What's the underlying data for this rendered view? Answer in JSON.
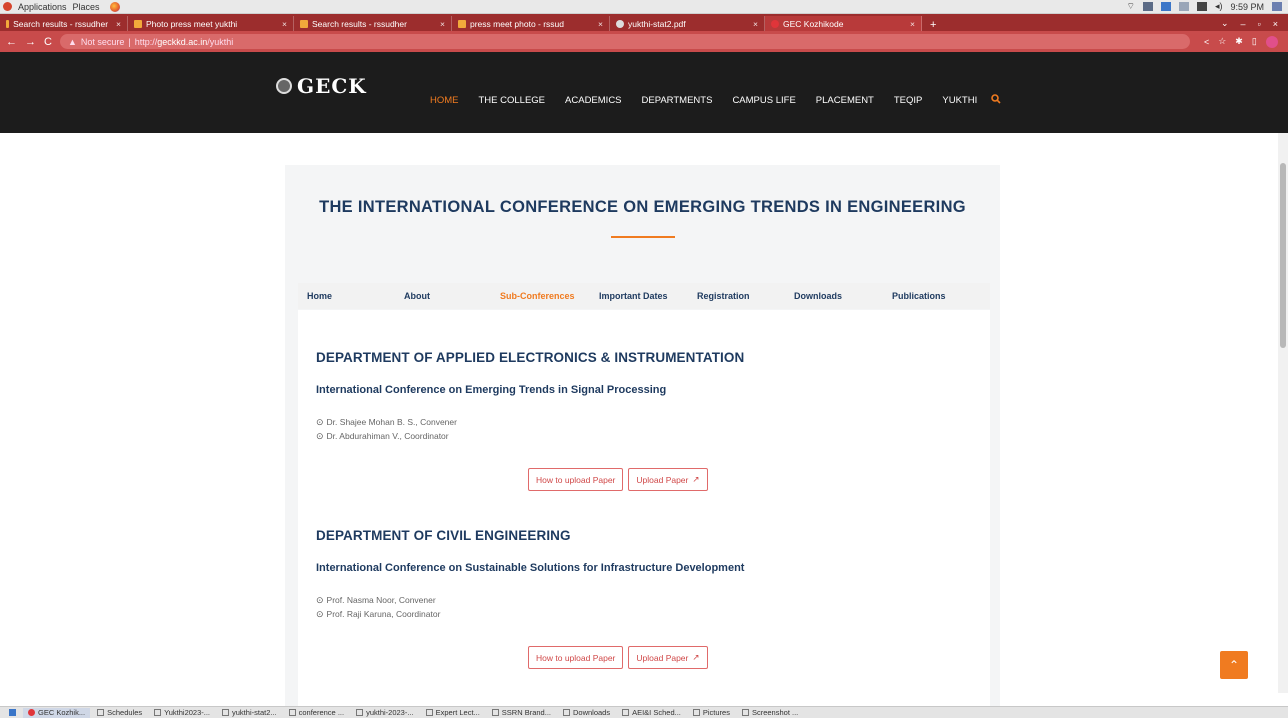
{
  "os_top": {
    "menu_applications": "Applications",
    "menu_places": "Places",
    "clock": "9:59 PM"
  },
  "browser": {
    "tabs": [
      {
        "label": "Search results - rssudher",
        "fav_color": "#f2a93b"
      },
      {
        "label": "Photo press meet yukthi",
        "fav_color": "#f2a93b"
      },
      {
        "label": "Search results - rssudher",
        "fav_color": "#f2a93b"
      },
      {
        "label": "press meet photo - rssud",
        "fav_color": "#f2a93b"
      },
      {
        "label": "yukthi-stat2.pdf",
        "fav_color": "#dddddd"
      },
      {
        "label": "GEC Kozhikode",
        "fav_color": "#e0353a",
        "active": true
      }
    ],
    "new_tab": "+",
    "security_label": "Not secure",
    "url_prefix": "http://",
    "url_host": "geckkd.ac.in",
    "url_path": "/yukthi"
  },
  "site": {
    "logo_text": "GECK",
    "nav": [
      "HOME",
      "THE COLLEGE",
      "ACADEMICS",
      "DEPARTMENTS",
      "CAMPUS LIFE",
      "PLACEMENT",
      "TEQIP",
      "YUKTHI"
    ],
    "active_nav": "HOME",
    "accent": "#f07b20",
    "title_color": "#1e3a5f"
  },
  "page": {
    "title": "THE INTERNATIONAL CONFERENCE ON EMERGING TRENDS IN ENGINEERING",
    "subtabs": [
      "Home",
      "About",
      "Sub-Conferences",
      "Important Dates",
      "Registration",
      "Downloads",
      "Publications"
    ],
    "active_subtab": "Sub-Conferences",
    "departments": [
      {
        "name": "DEPARTMENT OF APPLIED ELECTRONICS & INSTRUMENTATION",
        "conference": "International Conference on Emerging Trends in Signal Processing",
        "people": [
          "Dr. Shajee Mohan B. S., Convener",
          "Dr. Abdurahiman V., Coordinator"
        ],
        "btn_howto": "How to upload Paper",
        "btn_upload": "Upload Paper"
      },
      {
        "name": "DEPARTMENT OF CIVIL ENGINEERING",
        "conference": "International Conference on Sustainable Solutions for Infrastructure Development",
        "people": [
          "Prof. Nasma Noor, Convener",
          "Prof. Raji Karuna, Coordinator"
        ],
        "btn_howto": "How to upload Paper",
        "btn_upload": "Upload Paper"
      }
    ]
  },
  "taskbar": {
    "items": [
      "GEC Kozhik...",
      "Schedules",
      "Yukthi2023-...",
      "yukthi-stat2...",
      "conference ...",
      "yukthi-2023-...",
      "Expert Lect...",
      "SSRN Brand...",
      "Downloads",
      "AEI&I Sched...",
      "Pictures",
      "Screenshot ..."
    ]
  }
}
